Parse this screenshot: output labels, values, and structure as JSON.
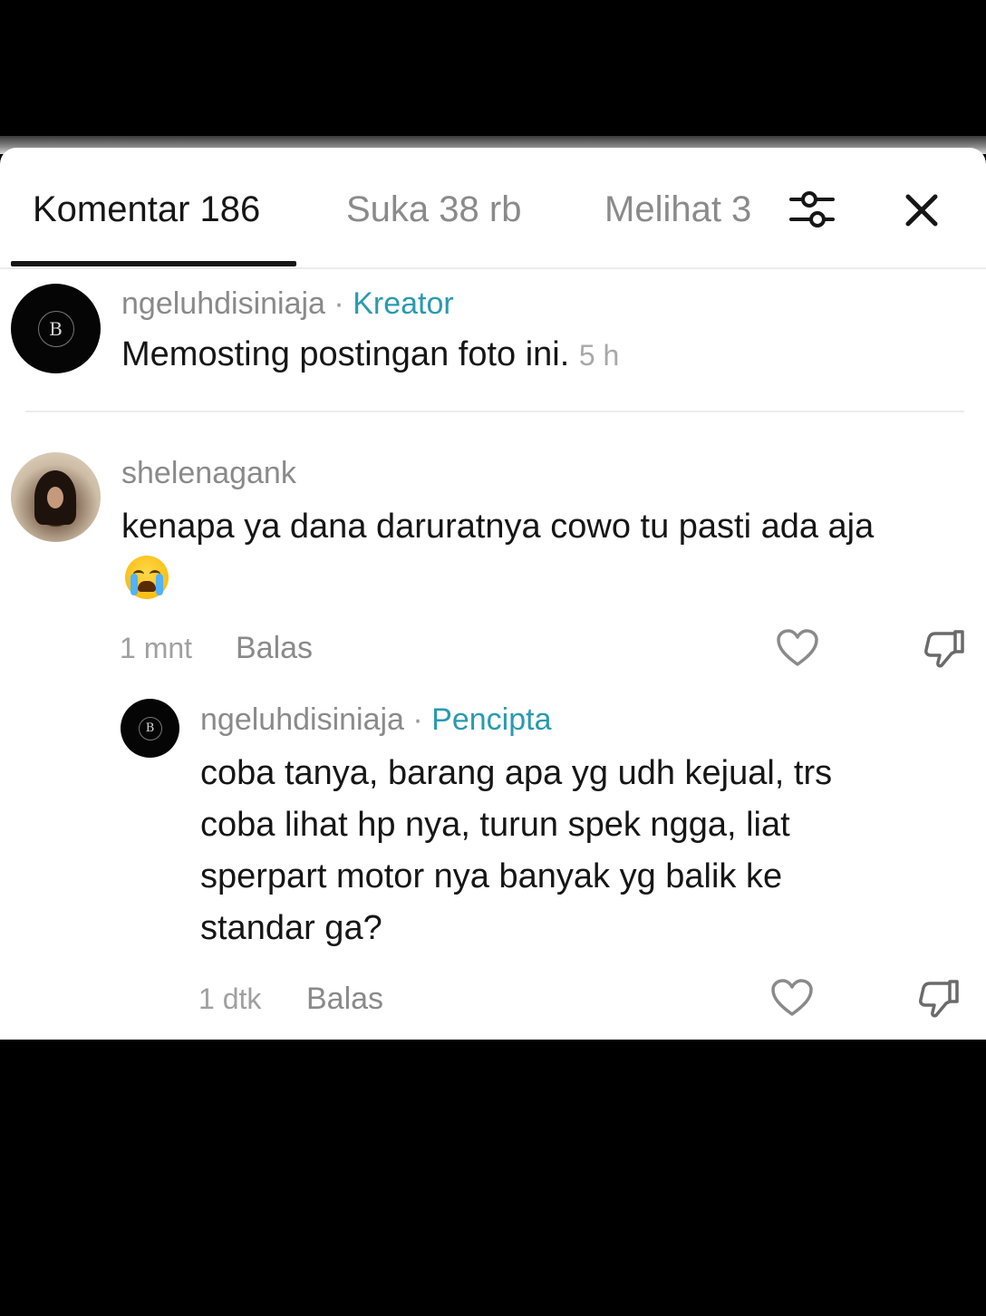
{
  "tabs": {
    "comments": "Komentar 186",
    "likes": "Suka 38 rb",
    "views": "Melihat 3"
  },
  "icons": {
    "filter": "sliders-icon",
    "close": "close-icon",
    "like": "heart-icon",
    "dislike": "thumbs-down-icon"
  },
  "creator_post": {
    "username": "ngeluhdisiniaja",
    "separator": "·",
    "badge": "Kreator",
    "text": "Memosting postingan foto ini.",
    "time": "5 h",
    "avatar_text": "B"
  },
  "comment": {
    "username": "shelenagank",
    "text": "kenapa ya dana daruratnya cowo tu pasti ada aja",
    "emoji": "😭",
    "time": "1 mnt",
    "reply_label": "Balas"
  },
  "reply": {
    "username": "ngeluhdisiniaja",
    "separator": "·",
    "badge": "Pencipta",
    "lines": [
      "coba tanya, barang apa yg udh kejual, trs",
      "coba lihat hp nya, turun spek ngga, liat",
      "sperpart motor nya banyak yg balik ke",
      "standar ga?"
    ],
    "time": "1 dtk",
    "reply_label": "Balas",
    "avatar_text": "B"
  },
  "colors": {
    "badge": "#2a9ab0",
    "muted": "#8a8a8a",
    "text": "#161616"
  }
}
